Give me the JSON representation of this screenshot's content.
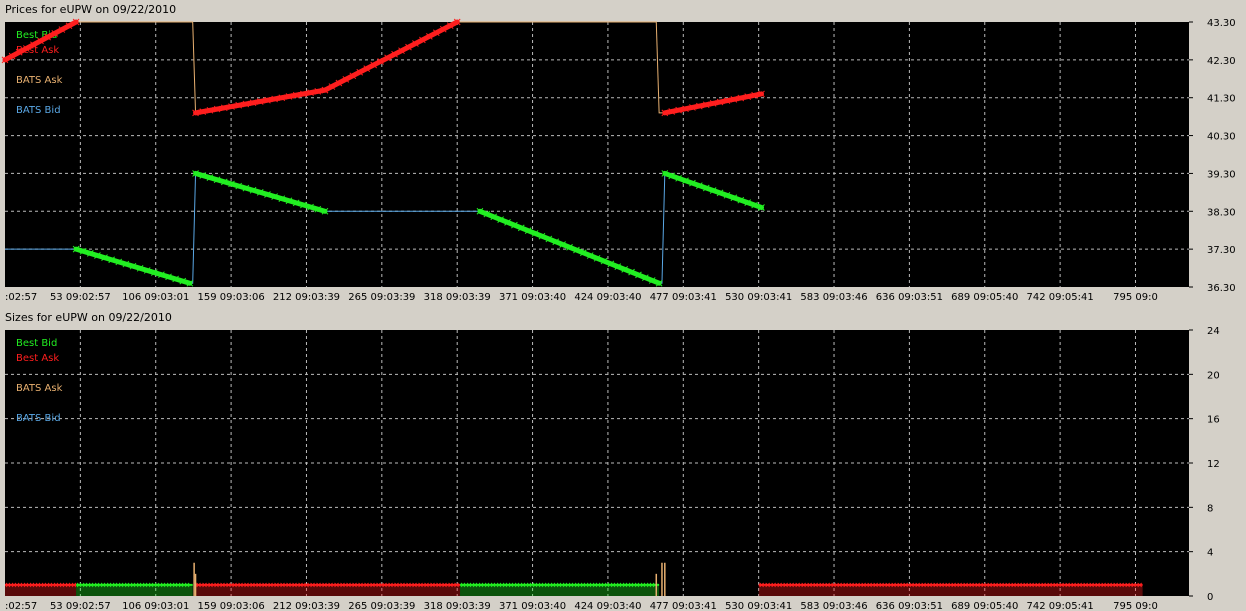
{
  "colors": {
    "best_bid": "#22ee22",
    "best_ask": "#ff1e1e",
    "bats_ask": "#e8b070",
    "bats_bid": "#5aa8e6",
    "panel_bg": "#d4d0c8",
    "plot_bg": "#000000",
    "grid": "#bbbbbb"
  },
  "x_tick_labels": [
    ":02:57",
    "53 09:02:57",
    "106 09:03:01",
    "159 09:03:06",
    "212 09:03:39",
    "265 09:03:39",
    "318 09:03:39",
    "371 09:03:40",
    "424 09:03:40",
    "477 09:03:41",
    "530 09:03:41",
    "583 09:03:46",
    "636 09:03:51",
    "689 09:05:40",
    "742 09:05:41",
    "795 09:0"
  ],
  "prices": {
    "title": "Prices for  eUPW  on  09/22/2010",
    "legend": [
      "Best Bid",
      "Best Ask",
      "BATS Ask",
      "BATS Bid"
    ],
    "y_tick_labels": [
      "43.30",
      "42.30",
      "41.30",
      "40.30",
      "39.30",
      "38.30",
      "37.30",
      "36.30"
    ]
  },
  "sizes": {
    "title": "Sizes for  eUPW  on  09/22/2010",
    "legend": [
      "Best Bid",
      "Best Ask",
      "BATS Ask",
      "BATS Bid"
    ],
    "y_tick_labels": [
      "24",
      "20",
      "16",
      "12",
      "8",
      "4",
      "0"
    ]
  },
  "chart_data": [
    {
      "type": "line",
      "title": "Prices for  eUPW  on  09/22/2010",
      "x_range": [
        0,
        800
      ],
      "ylim": [
        36.3,
        43.3
      ],
      "y_ticks": [
        43.3,
        42.3,
        41.3,
        40.3,
        39.3,
        38.3,
        37.3,
        36.3
      ],
      "x_ticks": [
        0,
        53,
        106,
        159,
        212,
        265,
        318,
        371,
        424,
        477,
        530,
        583,
        636,
        689,
        742,
        795
      ],
      "grid": true,
      "legend_position": "top-left",
      "series": [
        {
          "name": "Best Bid",
          "segments": [
            [
              [
                50,
                37.3
              ],
              [
                130,
                36.4
              ]
            ],
            [
              [
                134,
                39.3
              ],
              [
                225,
                38.3
              ]
            ],
            [
              [
                334,
                38.3
              ],
              [
                460,
                36.4
              ]
            ],
            [
              [
                464,
                39.3
              ],
              [
                532,
                38.4
              ]
            ]
          ]
        },
        {
          "name": "Best Ask",
          "segments": [
            [
              [
                0,
                42.3
              ],
              [
                50,
                43.3
              ]
            ],
            [
              [
                134,
                40.9
              ],
              [
                225,
                41.5
              ]
            ],
            [
              [
                225,
                41.5
              ],
              [
                318,
                43.3
              ]
            ],
            [
              [
                464,
                40.9
              ],
              [
                532,
                41.4
              ]
            ]
          ]
        },
        {
          "name": "BATS Ask",
          "points": [
            [
              0,
              42.3
            ],
            [
              50,
              43.3
            ],
            [
              132,
              43.3
            ],
            [
              134,
              40.9
            ],
            [
              225,
              41.5
            ],
            [
              318,
              43.3
            ],
            [
              458,
              43.3
            ],
            [
              460,
              40.9
            ],
            [
              464,
              40.9
            ],
            [
              532,
              41.4
            ]
          ]
        },
        {
          "name": "BATS Bid",
          "points": [
            [
              0,
              37.3
            ],
            [
              50,
              37.3
            ],
            [
              130,
              36.4
            ],
            [
              132,
              36.4
            ],
            [
              134,
              39.3
            ],
            [
              225,
              38.3
            ],
            [
              334,
              38.3
            ],
            [
              460,
              36.4
            ],
            [
              462,
              36.4
            ],
            [
              464,
              39.3
            ],
            [
              532,
              38.4
            ]
          ]
        }
      ]
    },
    {
      "type": "bar",
      "title": "Sizes for  eUPW  on  09/22/2010",
      "x_range": [
        0,
        800
      ],
      "ylim": [
        0,
        24
      ],
      "y_ticks": [
        24,
        20,
        16,
        12,
        8,
        4,
        0
      ],
      "x_ticks": [
        0,
        53,
        106,
        159,
        212,
        265,
        318,
        371,
        424,
        477,
        530,
        583,
        636,
        689,
        742,
        795
      ],
      "grid": true,
      "legend_position": "top-left",
      "series": [
        {
          "name": "Best Ask",
          "ranges": [
            [
              0,
              50,
              1
            ],
            [
              134,
              320,
              1
            ],
            [
              530,
              800,
              1
            ]
          ]
        },
        {
          "name": "Best Bid",
          "ranges": [
            [
              50,
              132,
              1
            ],
            [
              320,
              460,
              1
            ]
          ]
        },
        {
          "name": "BATS Ask",
          "spikes": [
            [
              133,
              3
            ],
            [
              134,
              2
            ],
            [
              458,
              2
            ],
            [
              462,
              3
            ],
            [
              464,
              3
            ]
          ]
        }
      ]
    }
  ]
}
